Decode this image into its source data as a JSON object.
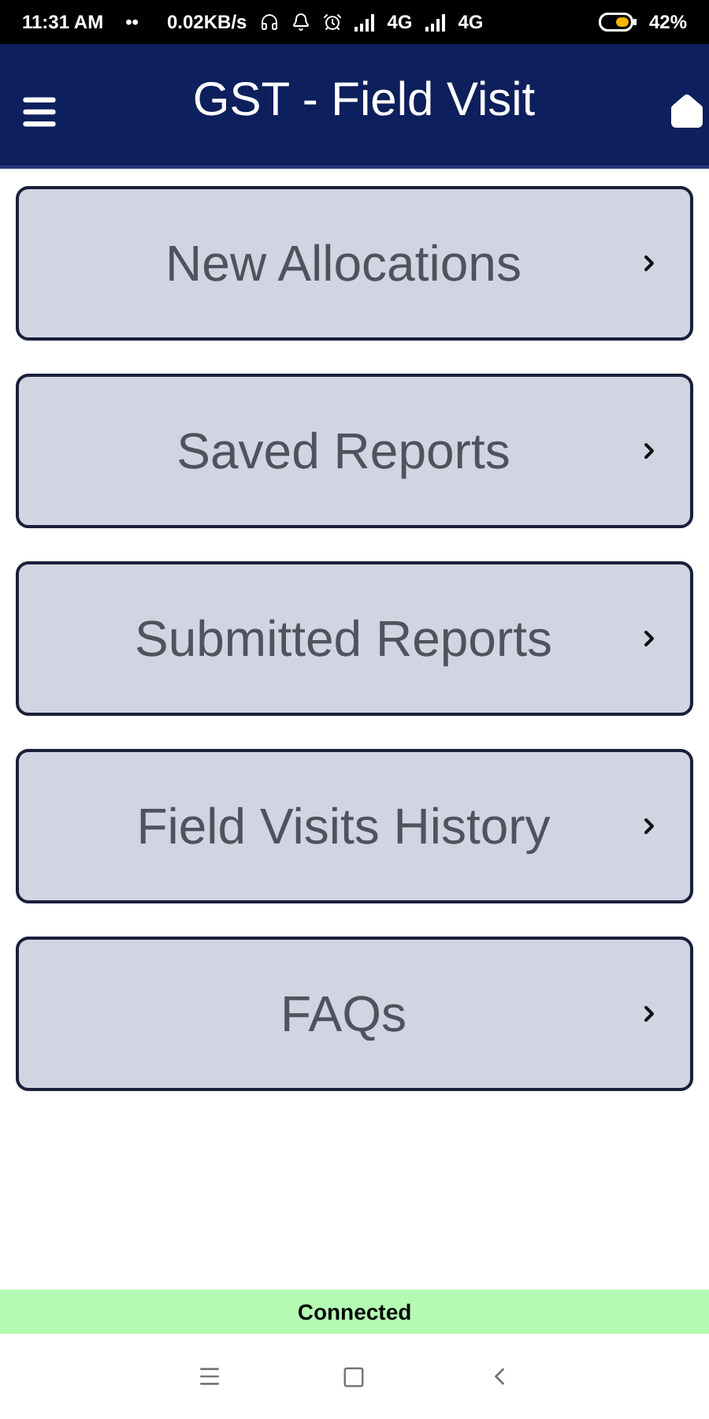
{
  "status_bar": {
    "time": "11:31 AM",
    "dots": "••",
    "speed": "0.02KB/s",
    "network_1": "4G",
    "network_2": "4G",
    "battery": "42%"
  },
  "app_bar": {
    "title": "GST - Field Visit"
  },
  "menu_items": [
    {
      "label": "New Allocations"
    },
    {
      "label": "Saved Reports"
    },
    {
      "label": "Submitted Reports"
    },
    {
      "label": "Field Visits History"
    },
    {
      "label": "FAQs"
    }
  ],
  "connection_banner": {
    "text": "Connected"
  }
}
